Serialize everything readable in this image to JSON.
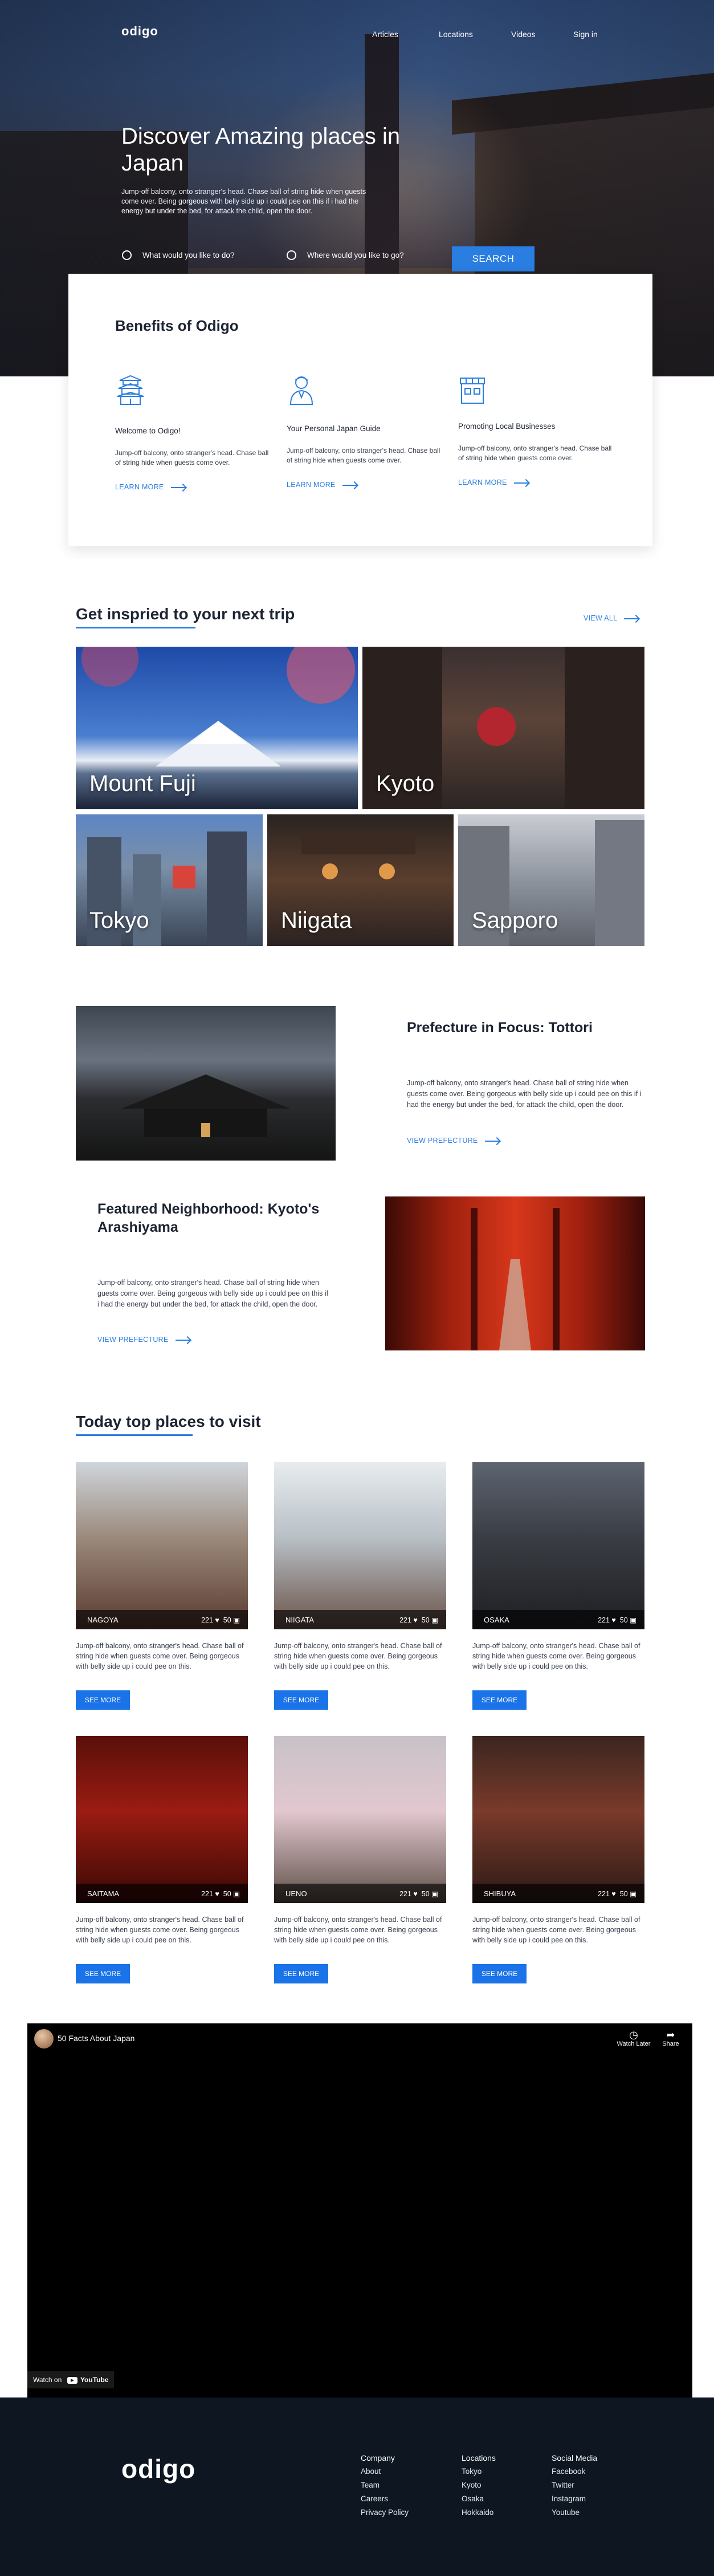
{
  "brand": {
    "logo": "odigo",
    "accent": "#2a7de1"
  },
  "nav": {
    "items": [
      "Articles",
      "Locations",
      "Videos",
      "Sign in"
    ]
  },
  "hero": {
    "title": "Discover Amazing places in Japan",
    "subtitle": "Jump-off balcony, onto stranger's head. Chase ball of string hide when guests come over. Being gorgeous with belly side up i could pee on this if i had the energy but under the bed, for attack the child, open the door.",
    "radio_options": [
      "What would you like to do?",
      "Where would you like to go?"
    ],
    "search_label": "SEARCH"
  },
  "benefits": {
    "title": "Benefits of Odigo",
    "items": [
      {
        "icon": "temple-icon",
        "title": "Welcome to Odigo!",
        "text": "Jump-off balcony, onto stranger's head. Chase ball of string hide when guests come over.",
        "link": "LEARN MORE"
      },
      {
        "icon": "guide-person-icon",
        "title": "Your Personal Japan Guide",
        "text": "Jump-off balcony, onto stranger's head. Chase ball of string hide when guests come over.",
        "link": "LEARN MORE"
      },
      {
        "icon": "shop-icon",
        "title": "Promoting Local Businesses",
        "text": "Jump-off balcony, onto stranger's head. Chase ball of string hide when guests come over.",
        "link": "LEARN MORE"
      }
    ]
  },
  "trip": {
    "title": "Get inspried to your next trip",
    "view_all": "VIEW ALL",
    "tiles": [
      "Mount Fuji",
      "Kyoto",
      "Tokyo",
      "Niigata",
      "Sapporo"
    ]
  },
  "features": [
    {
      "title": "Prefecture in Focus: Tottori",
      "text": "Jump-off balcony, onto stranger's head. Chase ball of string hide when guests come over. Being gorgeous with belly side up i could pee on this if i had the energy but under the bed, for attack the child, open the door.",
      "link": "VIEW PREFECTURE"
    },
    {
      "title": "Featured Neighborhood: Kyoto's Arashiyama",
      "text": "Jump-off balcony, onto stranger's head. Chase ball of string hide when guests come over. Being gorgeous with belly side up i could pee on this if i had the energy but under the bed, for attack the child, open the door.",
      "link": "VIEW PREFECTURE"
    }
  ],
  "places": {
    "title": "Today top places to visit",
    "button": "SEE MORE",
    "text": "Jump-off balcony, onto stranger's head. Chase ball of string hide when guests come over. Being gorgeous with belly side up i could pee on this.",
    "cards": [
      {
        "name": "NAGOYA",
        "likes": "221",
        "comments": "50"
      },
      {
        "name": "NIIGATA",
        "likes": "221",
        "comments": "50"
      },
      {
        "name": "OSAKA",
        "likes": "221",
        "comments": "50"
      },
      {
        "name": "SAITAMA",
        "likes": "221",
        "comments": "50"
      },
      {
        "name": "UENO",
        "likes": "221",
        "comments": "50"
      },
      {
        "name": "SHIBUYA",
        "likes": "221",
        "comments": "50"
      }
    ]
  },
  "video": {
    "title": "50 Facts About Japan",
    "watch_later": "Watch Later",
    "share": "Share",
    "watch_on": "Watch on",
    "youtube": "YouTube"
  },
  "footer": {
    "logo": "odigo",
    "columns": [
      {
        "head": "Company",
        "items": [
          "About",
          "Team",
          "Careers",
          "Privacy Policy"
        ]
      },
      {
        "head": "Locations",
        "items": [
          "Tokyo",
          "Kyoto",
          "Osaka",
          "Hokkaido"
        ]
      },
      {
        "head": "Social Media",
        "items": [
          "Facebook",
          "Twitter",
          "Instagram",
          "Youtube"
        ]
      }
    ]
  }
}
